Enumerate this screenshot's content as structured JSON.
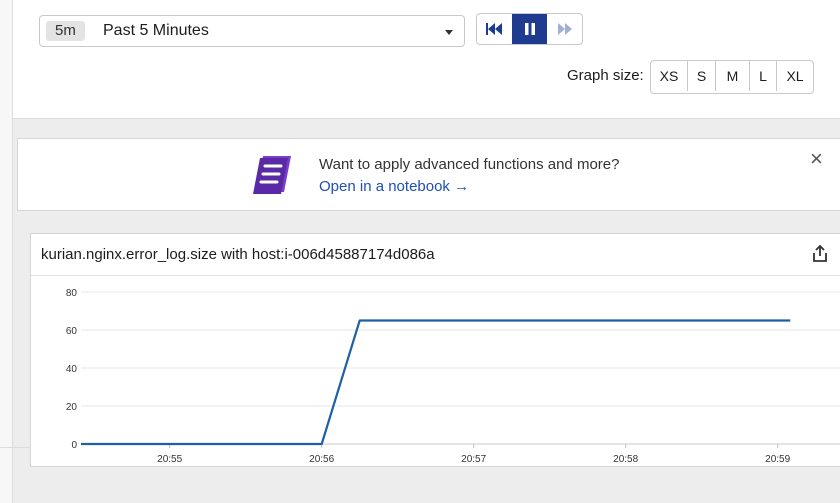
{
  "time_range": {
    "chip": "5m",
    "label": "Past 5 Minutes"
  },
  "playback": {
    "rewind": "rewind-icon",
    "pause": "pause-icon",
    "forward": "fast-forward-icon",
    "active": "pause"
  },
  "graph_size": {
    "label": "Graph size:",
    "options": [
      "XS",
      "S",
      "M",
      "L",
      "XL"
    ]
  },
  "promo": {
    "icon": "notebook-icon",
    "text": "Want to apply advanced functions and more?",
    "link": "Open in a notebook →",
    "close": "×"
  },
  "panel": {
    "title": "kurian.nginx.error_log.size with host:i-006d45887174d086a",
    "share_icon": "share-icon"
  },
  "colors": {
    "line": "#1f5fa8",
    "accent": "#1f3b8f",
    "icon_purple": "#7a3fc9"
  },
  "chart_data": {
    "type": "line",
    "title": "kurian.nginx.error_log.size with host:i-006d45887174d086a",
    "x_ticks": [
      "20:55",
      "20:56",
      "20:57",
      "20:58",
      "20:59"
    ],
    "y_ticks": [
      0,
      20,
      40,
      60,
      80
    ],
    "ylim": [
      0,
      80
    ],
    "xlim": [
      "20:54:25",
      "20:59:25"
    ],
    "grid": true,
    "series": [
      {
        "x": [
          "20:54:25",
          "20:56:00",
          "20:56:15",
          "20:59:05"
        ],
        "values": [
          0,
          0,
          65,
          65
        ]
      }
    ]
  }
}
